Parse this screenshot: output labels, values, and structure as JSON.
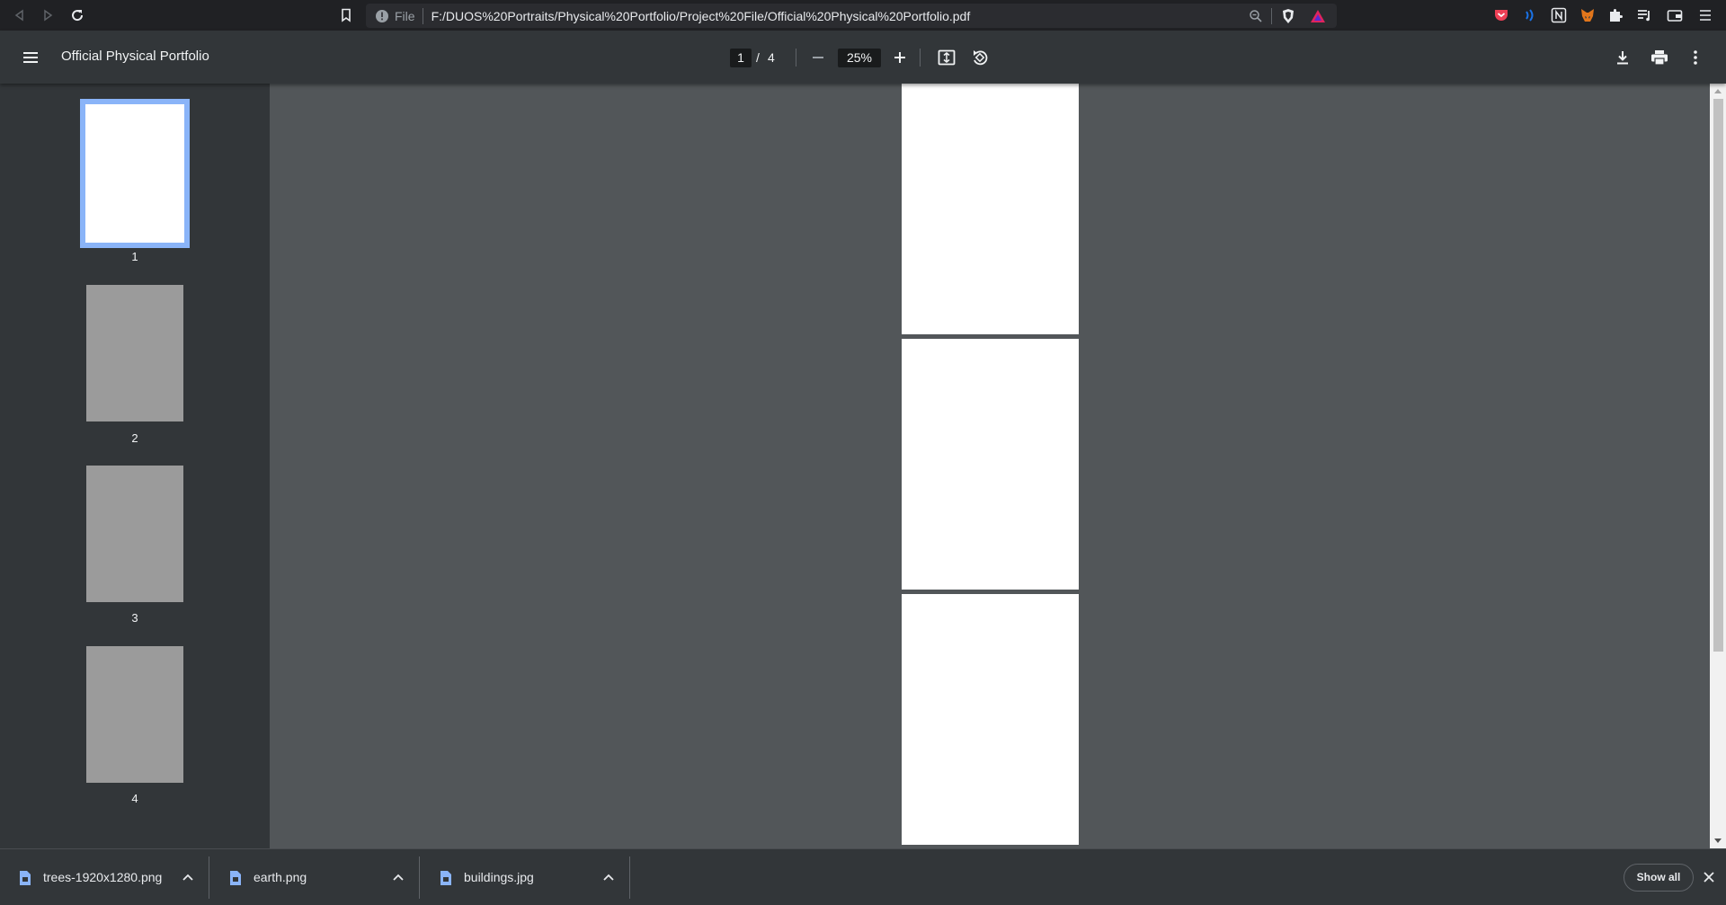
{
  "browser": {
    "url_scheme": "File",
    "url": "F:/DUOS%20Portraits/Physical%20Portfolio/Project%20File/Official%20Physical%20Portfolio.pdf",
    "accent_color": "#8ab4f8"
  },
  "pdf_toolbar": {
    "title": "Official Physical Portfolio",
    "current_page": "1",
    "page_separator": "/",
    "total_pages": "4",
    "zoom": "25%"
  },
  "sidebar": {
    "thumbnails": [
      {
        "label": "1",
        "active": true
      },
      {
        "label": "2",
        "active": false
      },
      {
        "label": "3",
        "active": false
      },
      {
        "label": "4",
        "active": false
      }
    ]
  },
  "downloads": {
    "items": [
      {
        "name": "trees-1920x1280.png"
      },
      {
        "name": "earth.png"
      },
      {
        "name": "buildings.jpg"
      }
    ],
    "show_all_label": "Show all"
  }
}
